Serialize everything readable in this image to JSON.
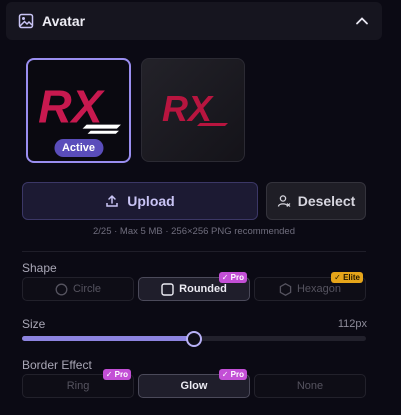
{
  "panel": {
    "title": "Avatar",
    "icon": "image-icon",
    "toggle_icon": "chevron-up-icon"
  },
  "avatars": [
    {
      "logo": "RX",
      "status": "Active"
    },
    {
      "logo": "RX"
    }
  ],
  "buttons": {
    "upload": "Upload",
    "deselect": "Deselect"
  },
  "hint": "2/25 · Max 5 MB · 256×256 PNG recommended",
  "shape": {
    "label": "Shape",
    "options": [
      {
        "label": "Circle",
        "tag": ""
      },
      {
        "label": "Rounded",
        "tag": "Pro",
        "selected": true
      },
      {
        "label": "Hexagon",
        "tag": "Elite"
      }
    ]
  },
  "size": {
    "label": "Size",
    "value_text": "112px",
    "fraction": 0.5
  },
  "border": {
    "label": "Border Effect",
    "options": [
      {
        "label": "Ring",
        "tag": "Pro"
      },
      {
        "label": "Glow",
        "tag": "Pro",
        "selected": true
      },
      {
        "label": "None",
        "tag": ""
      }
    ]
  },
  "colors": {
    "accent": "#8d84e0",
    "brand_logo": "#c8194f",
    "pro": "#c34fd6",
    "elite": "#e6a51a"
  }
}
